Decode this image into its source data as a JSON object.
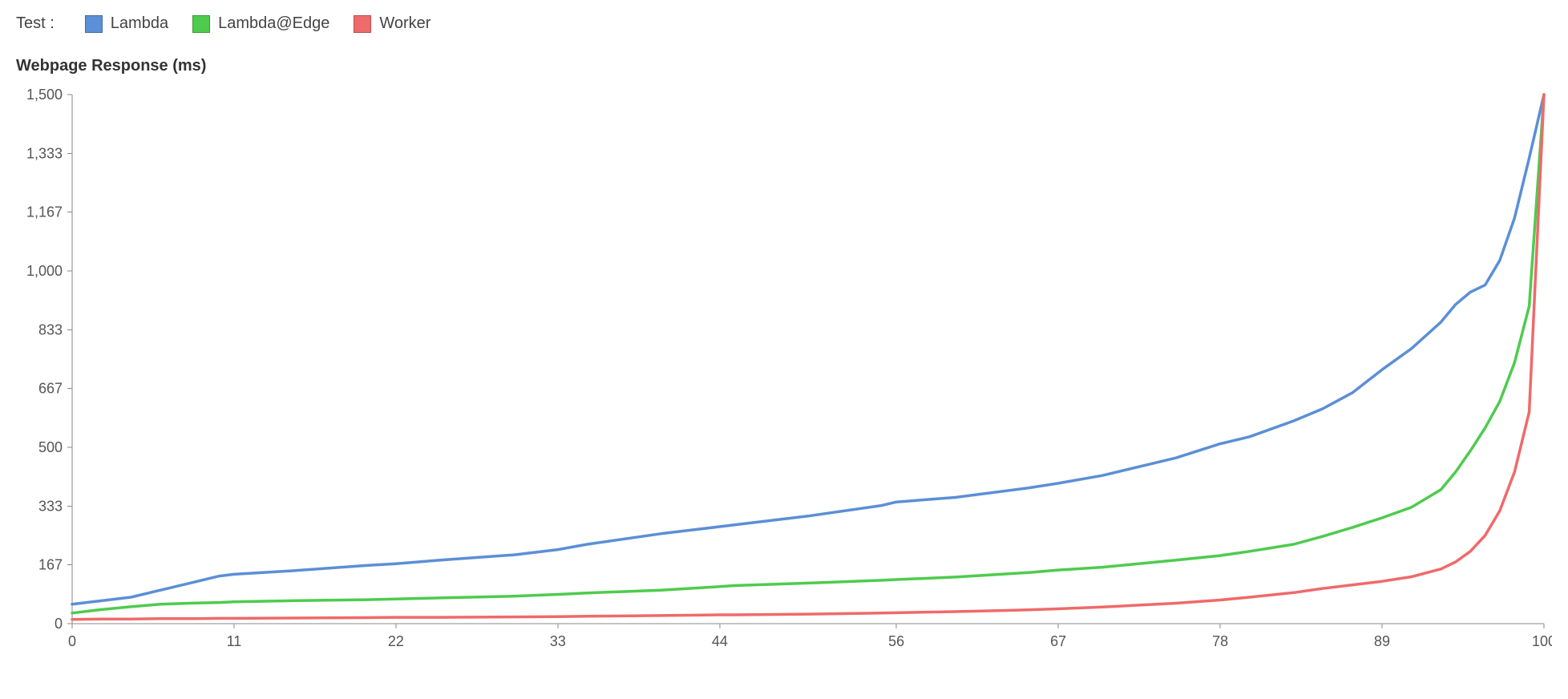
{
  "legend": {
    "title": "Test :",
    "items": [
      {
        "label": "Lambda",
        "color": "#5b8fd6"
      },
      {
        "label": "Lambda@Edge",
        "color": "#4ecb4e"
      },
      {
        "label": "Worker",
        "color": "#ef6a6a"
      }
    ]
  },
  "subtitle": "Webpage Response (ms)",
  "chart_data": {
    "type": "line",
    "xlabel": "",
    "ylabel": "",
    "xlim": [
      0,
      100
    ],
    "ylim": [
      0,
      1500
    ],
    "xticks": [
      0,
      11,
      22,
      33,
      44,
      56,
      67,
      78,
      89,
      100
    ],
    "yticks": [
      0,
      167,
      333,
      500,
      667,
      833,
      1000,
      1167,
      1333,
      1500
    ],
    "x": [
      0,
      2,
      4,
      6,
      8,
      10,
      11,
      15,
      20,
      22,
      25,
      30,
      33,
      35,
      40,
      44,
      45,
      50,
      55,
      56,
      60,
      65,
      67,
      70,
      75,
      78,
      80,
      83,
      85,
      87,
      89,
      91,
      93,
      94,
      95,
      96,
      97,
      98,
      99,
      100
    ],
    "series": [
      {
        "name": "Lambda",
        "color": "#5b8fd6",
        "values": [
          55,
          65,
          75,
          95,
          115,
          135,
          140,
          150,
          165,
          170,
          180,
          195,
          210,
          225,
          255,
          275,
          280,
          305,
          335,
          345,
          358,
          385,
          398,
          420,
          470,
          510,
          530,
          575,
          610,
          655,
          720,
          780,
          855,
          905,
          940,
          960,
          1030,
          1150,
          1320,
          1500
        ]
      },
      {
        "name": "Lambda@Edge",
        "color": "#4ecb4e",
        "values": [
          30,
          40,
          48,
          55,
          58,
          60,
          62,
          65,
          68,
          70,
          73,
          78,
          83,
          87,
          95,
          105,
          108,
          115,
          123,
          125,
          132,
          145,
          152,
          160,
          180,
          193,
          205,
          225,
          248,
          273,
          300,
          330,
          380,
          430,
          490,
          555,
          630,
          740,
          900,
          1500
        ]
      },
      {
        "name": "Worker",
        "color": "#ef6a6a",
        "values": [
          12,
          13,
          13,
          14,
          14,
          15,
          15,
          16,
          17,
          18,
          18,
          19,
          20,
          21,
          23,
          25,
          25,
          27,
          30,
          31,
          34,
          39,
          42,
          47,
          58,
          67,
          75,
          88,
          100,
          110,
          120,
          133,
          155,
          175,
          205,
          250,
          320,
          430,
          600,
          1500
        ]
      }
    ]
  }
}
